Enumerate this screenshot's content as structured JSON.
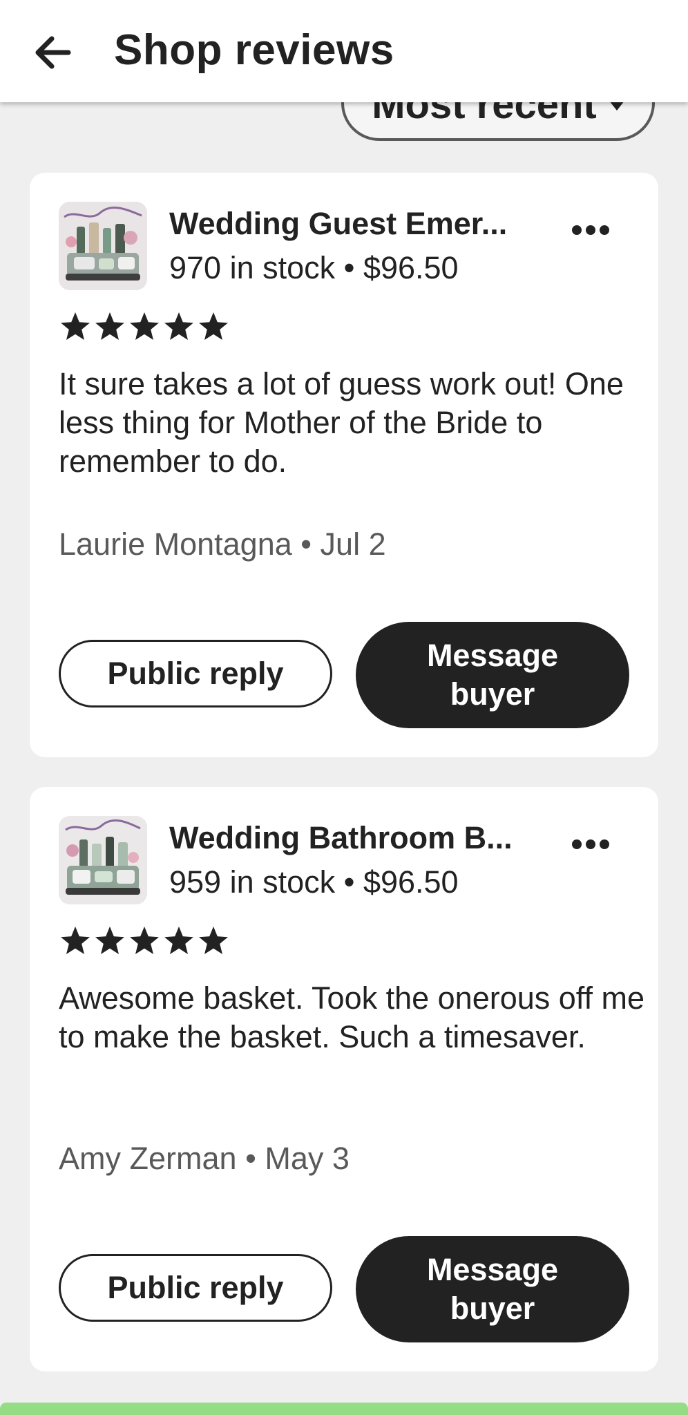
{
  "header": {
    "back_icon": "arrow-left-icon",
    "title": "Shop reviews"
  },
  "sort": {
    "label": "Most recent",
    "icon": "caret-down-icon"
  },
  "reviews": [
    {
      "listing_title": "Wedding Guest Emer...",
      "stock": "970 in stock",
      "separator": "•",
      "price": "$96.50",
      "rating": 5,
      "text": "It sure takes a lot of guess work out! One less thing for Mother of the Bride to remember to do.",
      "reviewer": "Laurie Montagna",
      "date": "Jul 2",
      "public_reply_label": "Public reply",
      "message_buyer_label": "Message buyer"
    },
    {
      "listing_title": "Wedding Bathroom B...",
      "stock": "959 in stock",
      "separator": "•",
      "price": "$96.50",
      "rating": 5,
      "text": "Awesome basket. Took the onerous off me to make the basket. Such a timesaver.",
      "reviewer": "Amy Zerman",
      "date": "May 3",
      "public_reply_label": "Public reply",
      "message_buyer_label": "Message buyer"
    }
  ],
  "colors": {
    "background": "#efefef",
    "card": "#ffffff",
    "text_primary": "#222222",
    "text_secondary": "#595959",
    "button_dark": "#222222",
    "bottom_accent": "#94dd85"
  }
}
